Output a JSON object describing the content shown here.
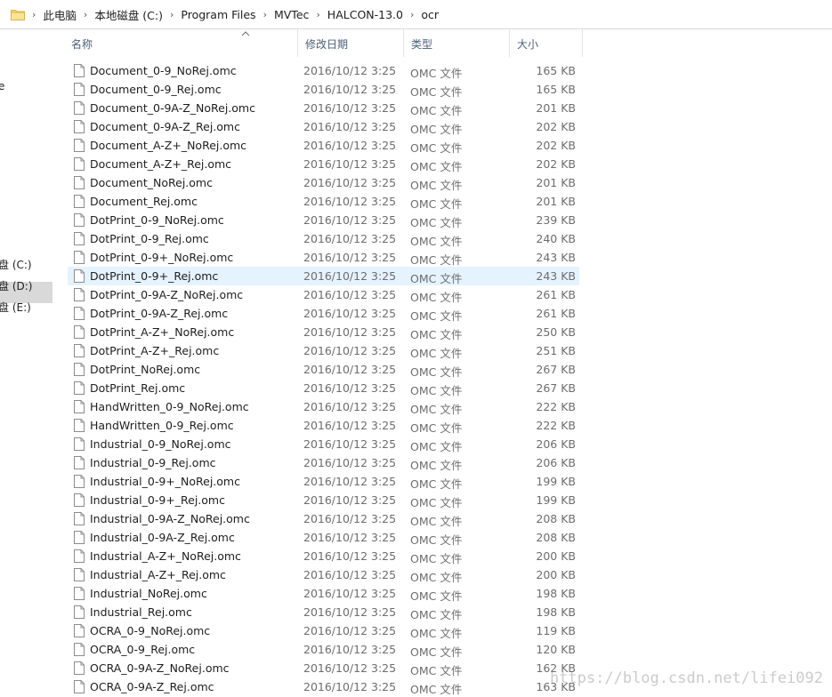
{
  "address_bar": {
    "icon": "folder-icon",
    "breadcrumbs": [
      "此电脑",
      "本地磁盘 (C:)",
      "Program Files",
      "MVTec",
      "HALCON-13.0",
      "ocr"
    ]
  },
  "nav_pane": {
    "fragment_top": "e",
    "drives": [
      "盘 (C:)",
      "盘 (D:)",
      "盘 (E:)"
    ],
    "selected_index": 0
  },
  "columns": {
    "name": "名称",
    "date": "修改日期",
    "type": "类型",
    "size": "大小"
  },
  "files": [
    {
      "name": "Document_0-9_NoRej.omc",
      "date": "2016/10/12 3:25",
      "type": "OMC 文件",
      "size": "165 KB"
    },
    {
      "name": "Document_0-9_Rej.omc",
      "date": "2016/10/12 3:25",
      "type": "OMC 文件",
      "size": "165 KB"
    },
    {
      "name": "Document_0-9A-Z_NoRej.omc",
      "date": "2016/10/12 3:25",
      "type": "OMC 文件",
      "size": "201 KB"
    },
    {
      "name": "Document_0-9A-Z_Rej.omc",
      "date": "2016/10/12 3:25",
      "type": "OMC 文件",
      "size": "202 KB"
    },
    {
      "name": "Document_A-Z+_NoRej.omc",
      "date": "2016/10/12 3:25",
      "type": "OMC 文件",
      "size": "202 KB"
    },
    {
      "name": "Document_A-Z+_Rej.omc",
      "date": "2016/10/12 3:25",
      "type": "OMC 文件",
      "size": "202 KB"
    },
    {
      "name": "Document_NoRej.omc",
      "date": "2016/10/12 3:25",
      "type": "OMC 文件",
      "size": "201 KB"
    },
    {
      "name": "Document_Rej.omc",
      "date": "2016/10/12 3:25",
      "type": "OMC 文件",
      "size": "201 KB"
    },
    {
      "name": "DotPrint_0-9_NoRej.omc",
      "date": "2016/10/12 3:25",
      "type": "OMC 文件",
      "size": "239 KB"
    },
    {
      "name": "DotPrint_0-9_Rej.omc",
      "date": "2016/10/12 3:25",
      "type": "OMC 文件",
      "size": "240 KB"
    },
    {
      "name": "DotPrint_0-9+_NoRej.omc",
      "date": "2016/10/12 3:25",
      "type": "OMC 文件",
      "size": "243 KB"
    },
    {
      "name": "DotPrint_0-9+_Rej.omc",
      "date": "2016/10/12 3:25",
      "type": "OMC 文件",
      "size": "243 KB"
    },
    {
      "name": "DotPrint_0-9A-Z_NoRej.omc",
      "date": "2016/10/12 3:25",
      "type": "OMC 文件",
      "size": "261 KB"
    },
    {
      "name": "DotPrint_0-9A-Z_Rej.omc",
      "date": "2016/10/12 3:25",
      "type": "OMC 文件",
      "size": "261 KB"
    },
    {
      "name": "DotPrint_A-Z+_NoRej.omc",
      "date": "2016/10/12 3:25",
      "type": "OMC 文件",
      "size": "250 KB"
    },
    {
      "name": "DotPrint_A-Z+_Rej.omc",
      "date": "2016/10/12 3:25",
      "type": "OMC 文件",
      "size": "251 KB"
    },
    {
      "name": "DotPrint_NoRej.omc",
      "date": "2016/10/12 3:25",
      "type": "OMC 文件",
      "size": "267 KB"
    },
    {
      "name": "DotPrint_Rej.omc",
      "date": "2016/10/12 3:25",
      "type": "OMC 文件",
      "size": "267 KB"
    },
    {
      "name": "HandWritten_0-9_NoRej.omc",
      "date": "2016/10/12 3:25",
      "type": "OMC 文件",
      "size": "222 KB"
    },
    {
      "name": "HandWritten_0-9_Rej.omc",
      "date": "2016/10/12 3:25",
      "type": "OMC 文件",
      "size": "222 KB"
    },
    {
      "name": "Industrial_0-9_NoRej.omc",
      "date": "2016/10/12 3:25",
      "type": "OMC 文件",
      "size": "206 KB"
    },
    {
      "name": "Industrial_0-9_Rej.omc",
      "date": "2016/10/12 3:25",
      "type": "OMC 文件",
      "size": "206 KB"
    },
    {
      "name": "Industrial_0-9+_NoRej.omc",
      "date": "2016/10/12 3:25",
      "type": "OMC 文件",
      "size": "199 KB"
    },
    {
      "name": "Industrial_0-9+_Rej.omc",
      "date": "2016/10/12 3:25",
      "type": "OMC 文件",
      "size": "199 KB"
    },
    {
      "name": "Industrial_0-9A-Z_NoRej.omc",
      "date": "2016/10/12 3:25",
      "type": "OMC 文件",
      "size": "208 KB"
    },
    {
      "name": "Industrial_0-9A-Z_Rej.omc",
      "date": "2016/10/12 3:25",
      "type": "OMC 文件",
      "size": "208 KB"
    },
    {
      "name": "Industrial_A-Z+_NoRej.omc",
      "date": "2016/10/12 3:25",
      "type": "OMC 文件",
      "size": "200 KB"
    },
    {
      "name": "Industrial_A-Z+_Rej.omc",
      "date": "2016/10/12 3:25",
      "type": "OMC 文件",
      "size": "200 KB"
    },
    {
      "name": "Industrial_NoRej.omc",
      "date": "2016/10/12 3:25",
      "type": "OMC 文件",
      "size": "198 KB"
    },
    {
      "name": "Industrial_Rej.omc",
      "date": "2016/10/12 3:25",
      "type": "OMC 文件",
      "size": "198 KB"
    },
    {
      "name": "OCRA_0-9_NoRej.omc",
      "date": "2016/10/12 3:25",
      "type": "OMC 文件",
      "size": "119 KB"
    },
    {
      "name": "OCRA_0-9_Rej.omc",
      "date": "2016/10/12 3:25",
      "type": "OMC 文件",
      "size": "120 KB"
    },
    {
      "name": "OCRA_0-9A-Z_NoRej.omc",
      "date": "2016/10/12 3:25",
      "type": "OMC 文件",
      "size": "162 KB"
    },
    {
      "name": "OCRA_0-9A-Z_Rej.omc",
      "date": "2016/10/12 3:25",
      "type": "OMC 文件",
      "size": "163 KB"
    }
  ],
  "selected_file_index": 11,
  "watermark": "https://blog.csdn.net/lifei092",
  "colors": {
    "selection_bg": "#e5f3ff",
    "nav_selection_bg": "#d9d9d9",
    "header_text": "#4c607a",
    "secondary_text": "#6d6d6d"
  }
}
